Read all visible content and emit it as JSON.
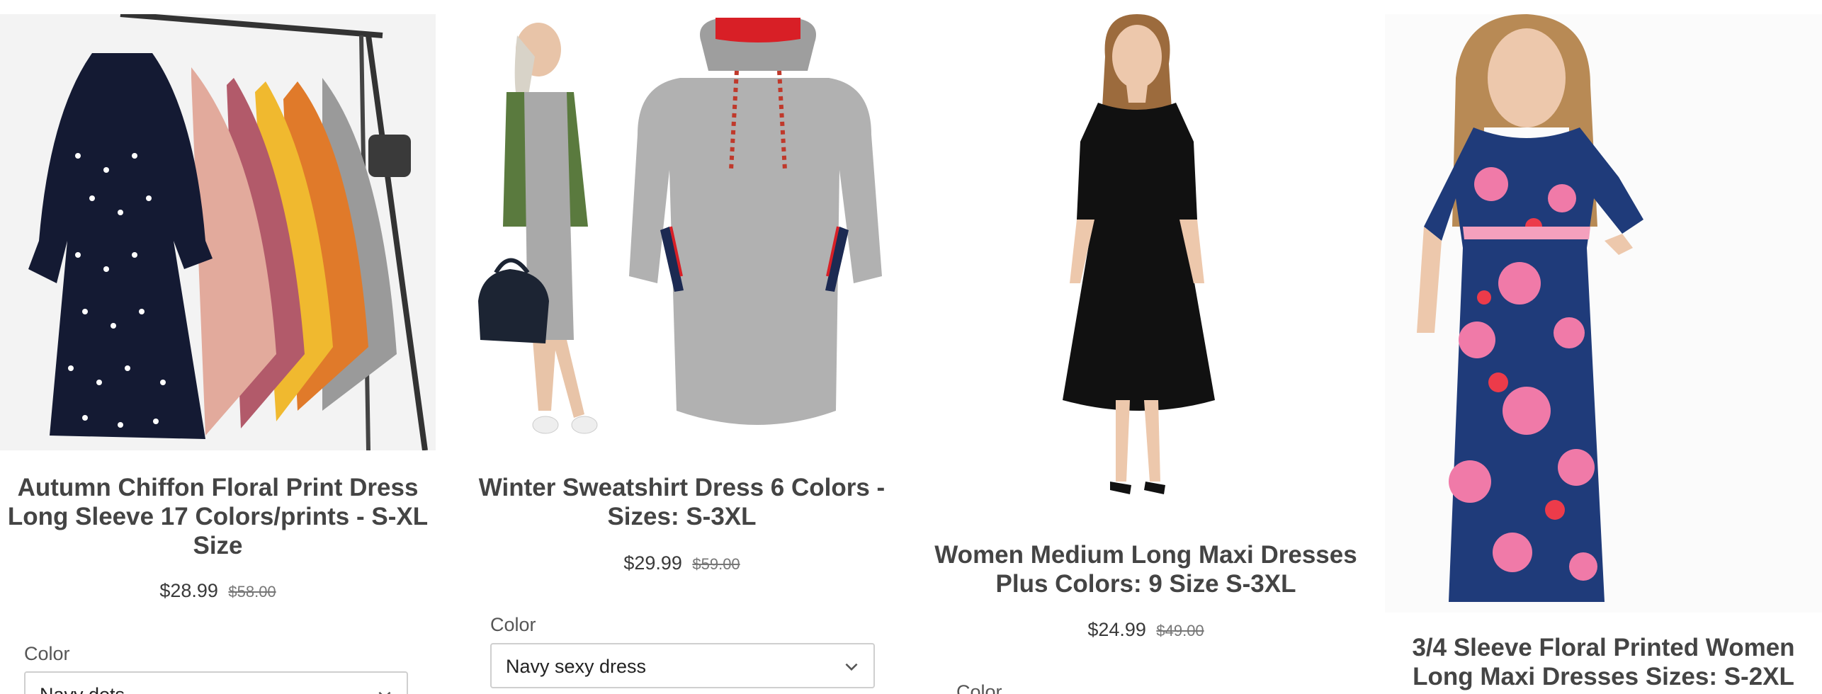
{
  "products": [
    {
      "title": "Autumn Chiffon Floral Print Dress Long Sleeve 17 Colors/prints - S-XL Size",
      "price": "$28.99",
      "compare_price": "$58.00",
      "option_label": "Color",
      "option_value": "Navy dots",
      "image_icon": "dresses-on-rack-image"
    },
    {
      "title": "Winter Sweatshirt Dress 6 Colors - Sizes: S-3XL",
      "price": "$29.99",
      "compare_price": "$59.00",
      "option_label": "Color",
      "option_value": "Navy sexy dress",
      "image_icon": "gray-hoodie-dress-image"
    },
    {
      "title": "Women Medium Long Maxi Dresses Plus Colors: 9 Size S-3XL",
      "price": "$24.99",
      "compare_price": "$49.00",
      "option_label": "Color",
      "image_icon": "black-midi-dress-model-image"
    },
    {
      "title": "3/4 Sleeve Floral Printed Women Long Maxi Dresses Sizes: S-2XL",
      "image_icon": "floral-maxi-dress-model-image"
    }
  ],
  "colors": {
    "text": "#3a3a3a",
    "compare_price": "#777777",
    "select_border": "#cfcfcf",
    "hood_red": "#d81f26",
    "navy": "#1c2a52"
  }
}
